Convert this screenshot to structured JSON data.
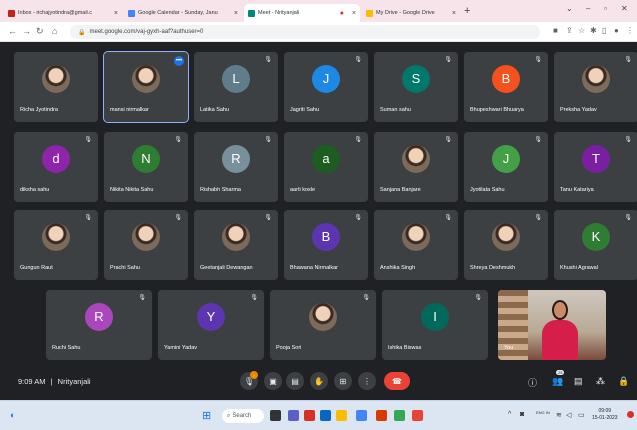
{
  "browser": {
    "tabs": [
      {
        "title": "Inbox - richajyotindra@gmail.c",
        "fav_color": "#c5221f",
        "active": false
      },
      {
        "title": "Google Calendar - Sunday, Janu",
        "fav_color": "#4285f4",
        "active": false
      },
      {
        "title": "Meet - Nrityanjali",
        "fav_color": "#00897b",
        "active": true
      },
      {
        "title": "My Drive - Google Drive",
        "fav_color": "#fbbc04",
        "active": false
      }
    ],
    "new_tab": "+",
    "url": "meet.google.com/vaj-gyxh-aaf?authuser=0"
  },
  "participants": [
    {
      "name": "Richa Jyotindra",
      "initial": "",
      "color": "",
      "photo": true
    },
    {
      "name": "mansi nirmalkar",
      "initial": "",
      "color": "",
      "photo": true,
      "selected": true
    },
    {
      "name": "Latika Sahu",
      "initial": "L",
      "color": "#607d8b"
    },
    {
      "name": "Jagriti Sahu",
      "initial": "J",
      "color": "#1e88e5"
    },
    {
      "name": "Suman sahu",
      "initial": "S",
      "color": "#00796b"
    },
    {
      "name": "Bhupeshwari Bhuarya",
      "initial": "B",
      "color": "#f4511e"
    },
    {
      "name": "Preksha Yadav",
      "initial": "",
      "color": "",
      "photo": true
    },
    {
      "name": "diksha sahu",
      "initial": "d",
      "color": "#8e24aa"
    },
    {
      "name": "Nikita Nikita Sahu",
      "initial": "N",
      "color": "#2e7d32"
    },
    {
      "name": "Rishabh Sharma",
      "initial": "R",
      "color": "#78909c"
    },
    {
      "name": "aarti kosle",
      "initial": "a",
      "color": "#1b5e20"
    },
    {
      "name": "Sanjana Banjare",
      "initial": "",
      "color": "",
      "photo": true
    },
    {
      "name": "Jyotilata Sahu",
      "initial": "J",
      "color": "#43a047"
    },
    {
      "name": "Tanu Katariya",
      "initial": "T",
      "color": "#7b1fa2"
    },
    {
      "name": "Gungun Raut",
      "initial": "",
      "color": "",
      "photo": true
    },
    {
      "name": "Prachi Sahu",
      "initial": "",
      "color": "",
      "photo": true
    },
    {
      "name": "Geetanjali Dewangan",
      "initial": "",
      "color": "",
      "photo": true
    },
    {
      "name": "Bhawana Nirmalkar",
      "initial": "B",
      "color": "#5e35b1"
    },
    {
      "name": "Anshika Singh",
      "initial": "",
      "color": "",
      "photo": true
    },
    {
      "name": "Shreya Deshmukh",
      "initial": "",
      "color": "",
      "photo": true
    },
    {
      "name": "Khushi Agrawal",
      "initial": "K",
      "color": "#2e7d32"
    },
    {
      "name": "Ruchi Sahu",
      "initial": "R",
      "color": "#ab47bc"
    },
    {
      "name": "Yamini Yadav",
      "initial": "Y",
      "color": "#5e35b1"
    },
    {
      "name": "Pooja Sori",
      "initial": "",
      "color": "",
      "photo": true
    },
    {
      "name": "Ishika Biswas",
      "initial": "I",
      "color": "#00695c"
    }
  ],
  "self_view": {
    "name": "You"
  },
  "meeting": {
    "time": "9:09 AM",
    "separator": "|",
    "title": "Nrityanjali",
    "badge_count": "25"
  },
  "taskbar": {
    "search_label": "Search",
    "clock_time": "09:09",
    "clock_date": "15-01-2023",
    "tray_lang": "ENG IN"
  },
  "icons": {
    "mic": "microphone-icon",
    "cam": "camera-icon",
    "cc": "captions-icon",
    "hand": "raise-hand-icon",
    "present": "present-icon",
    "more": "more-icon",
    "hangup": "hang-up-icon",
    "info": "info-icon",
    "people": "people-icon",
    "chat": "chat-icon",
    "activities": "activities-icon",
    "lock": "host-controls-icon"
  }
}
